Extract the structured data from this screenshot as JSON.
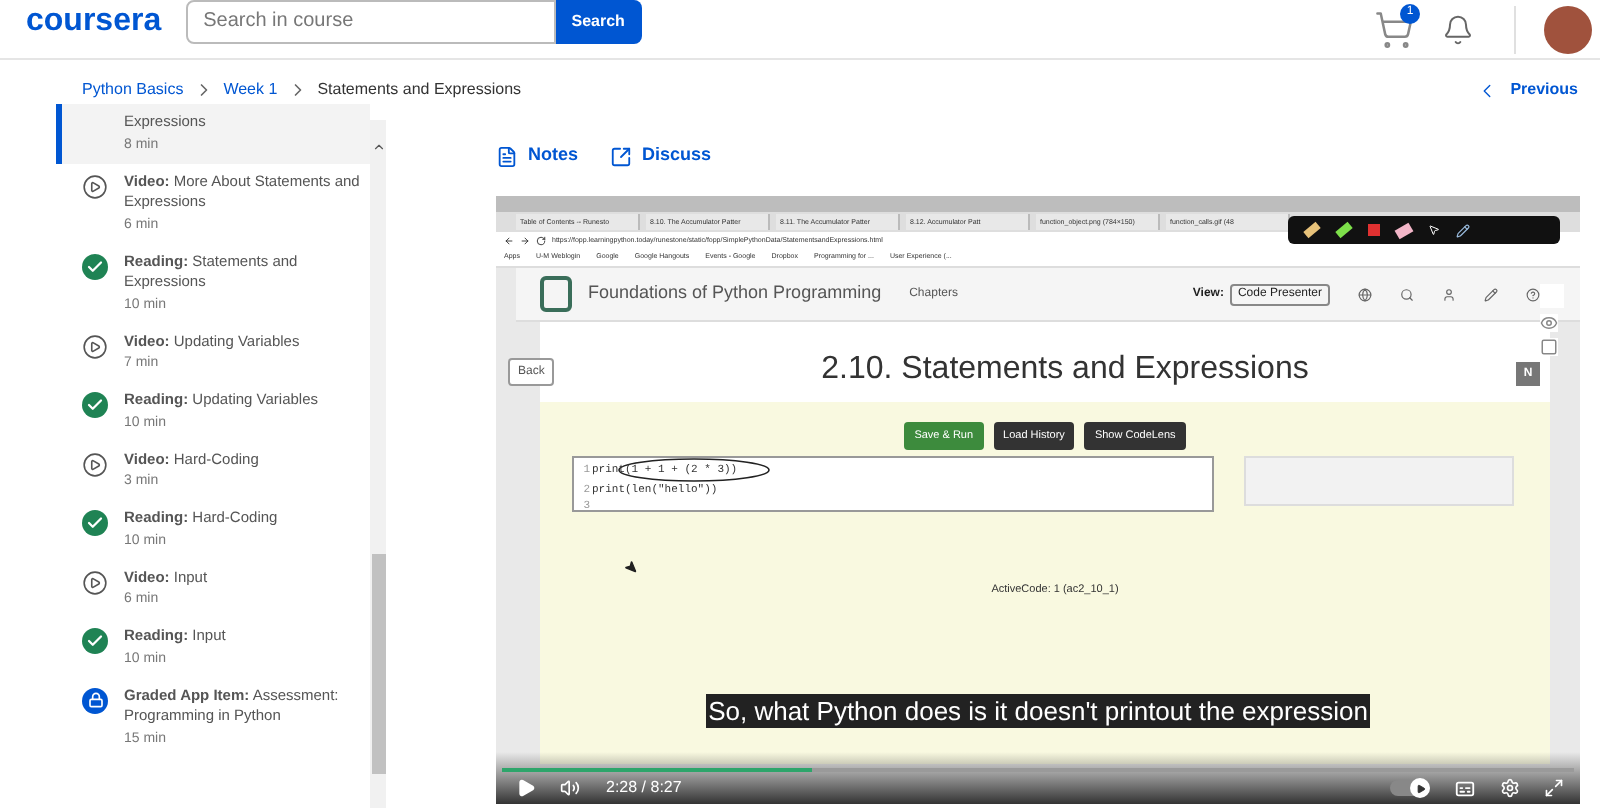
{
  "header": {
    "logo": "coursera",
    "search": {
      "placeholder": "Search in course",
      "button": "Search"
    },
    "cart_badge": "1"
  },
  "breadcrumb": [
    {
      "label": "Python Basics",
      "link": true
    },
    {
      "label": "Week 1",
      "link": true
    },
    {
      "label": "Statements and Expressions",
      "link": false
    }
  ],
  "previous": "Previous",
  "sidebar": {
    "items": [
      {
        "label": "Expressions",
        "duration": "8 min",
        "selected": true
      },
      {
        "kind": "video",
        "label": "**Video:** More About Statements and Expressions",
        "duration": "6 min",
        "selected": false
      },
      {
        "kind": "reading",
        "label": "**Reading:** Statements and Expressions",
        "duration": "10 min",
        "selected": false
      },
      {
        "kind": "video",
        "label": "**Video:** Updating Variables",
        "duration": "7 min",
        "selected": false
      },
      {
        "kind": "reading",
        "label": "**Reading:** Updating Variables",
        "duration": "10 min",
        "selected": false
      },
      {
        "kind": "video",
        "label": "**Video:** Hard-Coding",
        "duration": "3 min",
        "selected": false
      },
      {
        "kind": "reading",
        "label": "**Reading:** Hard-Coding",
        "duration": "10 min",
        "selected": false
      },
      {
        "kind": "video",
        "label": "**Video:** Input",
        "duration": "6 min",
        "selected": false
      },
      {
        "kind": "reading",
        "label": "**Reading:** Input",
        "duration": "10 min",
        "selected": false
      },
      {
        "kind": "graded",
        "label": "**Graded App Item:** Assessment: Programming in Python",
        "duration": "15 min",
        "selected": false
      }
    ]
  },
  "links": [
    {
      "kind": "notes",
      "label": "Notes"
    },
    {
      "kind": "discuss",
      "label": "Discuss"
    }
  ],
  "video": {
    "screen": {
      "browser_tabs": [
        "Table of Contents -- Runesto",
        "8.10. The Accumulator Patter",
        "8.11. The Accumulator Patter",
        "8.12. Accumulator Patt",
        "function_object.png (784×150)",
        "function_calls.gif (48"
      ],
      "url": "https://fopp.learningpython.today/runestone/static/fopp/SimplePythonData/StatementsandExpressions.html",
      "bookmarks": [
        "Apps",
        "U-M Weblogin",
        "Google",
        "Google Hangouts",
        "Events - Google",
        "Dropbox",
        "Programming for ...",
        "User Experience (..."
      ],
      "site_title": "Foundations of Python Programming",
      "chapters": "Chapters",
      "view_label": "View:",
      "view_value": "Code Presenter",
      "back": "Back",
      "next": "N",
      "heading": "2.10. Statements and Expressions",
      "buttons": [
        {
          "kind": "run",
          "label": "Save & Run"
        },
        {
          "kind": "plain",
          "label": "Load History"
        },
        {
          "kind": "plain",
          "label": "Show CodeLens"
        }
      ],
      "code": [
        {
          "n": "1",
          "code": "print(1 + 1 + (2 * 3))",
          "circled": true
        },
        {
          "n": "2",
          "code": "print(len(\"hello\"))",
          "circled": false
        },
        {
          "n": "3",
          "circled": false
        }
      ],
      "active_code": "ActiveCode: 1 (ac2_10_1)"
    },
    "caption": "So, what Python does is it doesn't printout the expression",
    "progress": {
      "level": 0.29
    },
    "time": "2:28 / 8:27",
    "autoplay": {
      "on": true
    }
  }
}
